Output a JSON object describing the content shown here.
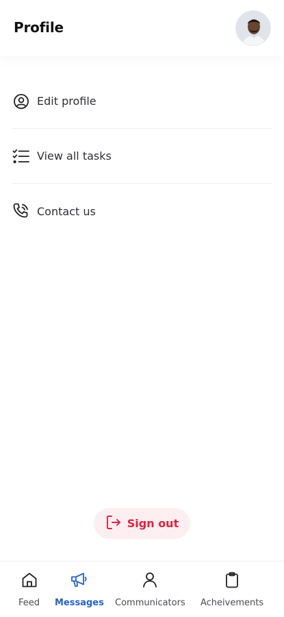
{
  "header": {
    "title": "Profile",
    "avatar_icon": "user-avatar-photo"
  },
  "menu": {
    "items": [
      {
        "label": "Edit profile",
        "icon": "user-circle-icon"
      },
      {
        "label": "View all tasks",
        "icon": "checklist-icon"
      },
      {
        "label": "Contact us",
        "icon": "phone-icon"
      }
    ]
  },
  "signout": {
    "label": "Sign out",
    "icon": "sign-out-icon",
    "color": "#e0213f",
    "bg": "#fdeff1"
  },
  "tabbar": {
    "active_color": "#2563c9",
    "tabs": [
      {
        "label": "Feed",
        "icon": "home-icon"
      },
      {
        "label": "Messages",
        "icon": "megaphone-icon",
        "active": true
      },
      {
        "label": "Communicators",
        "icon": "person-icon"
      },
      {
        "label": "Acheivements",
        "icon": "clipboard-icon"
      }
    ]
  }
}
